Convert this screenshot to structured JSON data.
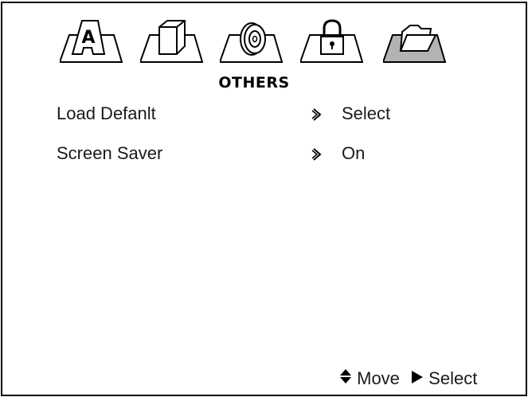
{
  "menu": {
    "title": "OTHERS",
    "tabs": [
      {
        "icon": "letter-a-icon",
        "glyph": "A",
        "active": false
      },
      {
        "icon": "box-icon",
        "active": false
      },
      {
        "icon": "disc-icon",
        "active": false
      },
      {
        "icon": "lock-icon",
        "active": false
      },
      {
        "icon": "folder-icon",
        "active": true
      }
    ],
    "items": [
      {
        "label": "Load Defanlt",
        "value": "Select"
      },
      {
        "label": "Screen Saver",
        "value": "On"
      }
    ]
  },
  "footer": {
    "move_label": "Move",
    "select_label": "Select"
  },
  "colors": {
    "active_tab_fill": "#b3b3b3",
    "border": "#000000"
  }
}
